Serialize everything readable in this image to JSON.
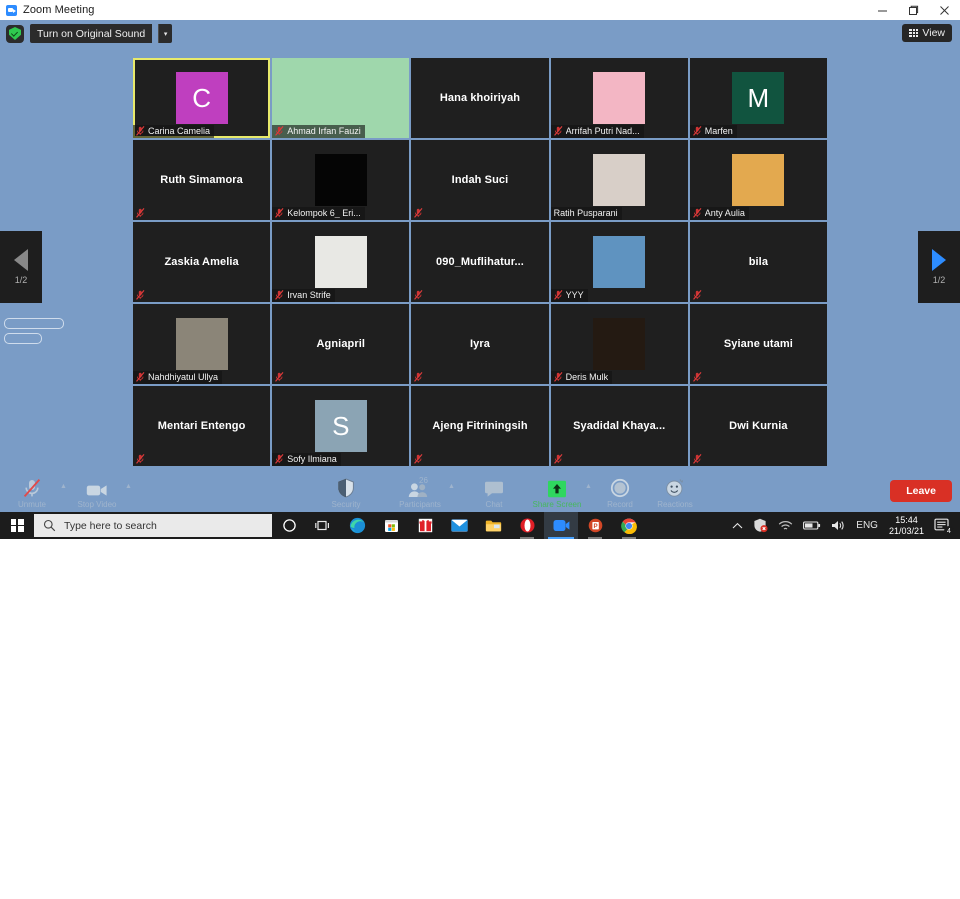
{
  "window": {
    "title": "Zoom Meeting",
    "app_icon": "zoom-icon",
    "minimize": "minimize-icon",
    "maximize": "maximize-icon",
    "close": "close-icon"
  },
  "topbar": {
    "shield_icon": "shield-check-icon",
    "original_sound_label": "Turn on Original Sound",
    "original_sound_caret": "▾",
    "view_label": "View",
    "view_icon": "grid-icon"
  },
  "gallery": {
    "page_prev_label": "1/2",
    "page_next_label": "1/2",
    "active_speaker": "Carina Camelia",
    "participants": [
      {
        "name": "Carina Camelia",
        "display": "bottom",
        "muted": true,
        "kind": "avatar-letter",
        "letter": "C",
        "color": "#bf3fbf",
        "active": true
      },
      {
        "name": "Ahmad Irfan Fauzi",
        "display": "bottom",
        "muted": true,
        "kind": "video",
        "color": "#9fd7ac"
      },
      {
        "name": "Hana khoiriyah",
        "display": "center",
        "muted": false,
        "kind": "none"
      },
      {
        "name": "Arrifah Putri Nad...",
        "display": "bottom",
        "muted": true,
        "kind": "photo",
        "color": "#f3b6c4"
      },
      {
        "name": "Marfen",
        "display": "bottom",
        "muted": true,
        "kind": "avatar-letter",
        "letter": "M",
        "color": "#11543f"
      },
      {
        "name": "Ruth Simamora",
        "display": "center",
        "muted": true,
        "kind": "none"
      },
      {
        "name": "Kelompok 6_ Eri...",
        "display": "bottom",
        "muted": true,
        "kind": "photo",
        "color": "#050505"
      },
      {
        "name": "Indah Suci",
        "display": "center",
        "muted": true,
        "kind": "none"
      },
      {
        "name": "Ratih Pusparani",
        "display": "bottom",
        "muted": false,
        "kind": "photo",
        "color": "#d8cfc8"
      },
      {
        "name": "Anty Aulia",
        "display": "bottom",
        "muted": true,
        "kind": "photo",
        "color": "#e3a94f"
      },
      {
        "name": "Zaskia Amelia",
        "display": "center",
        "muted": true,
        "kind": "none"
      },
      {
        "name": "Irvan Strife",
        "display": "bottom",
        "muted": true,
        "kind": "photo",
        "color": "#e8e8e4"
      },
      {
        "name": "090_Muflihatur...",
        "display": "center",
        "muted": true,
        "kind": "none"
      },
      {
        "name": "YYY",
        "display": "bottom",
        "muted": true,
        "kind": "photo",
        "color": "#5f93c0"
      },
      {
        "name": "bila",
        "display": "center",
        "muted": true,
        "kind": "none"
      },
      {
        "name": "Nahdhiyatul Ullya",
        "display": "bottom",
        "muted": true,
        "kind": "photo",
        "color": "#8b8578"
      },
      {
        "name": "Agniapril",
        "display": "center",
        "muted": true,
        "kind": "none"
      },
      {
        "name": "Iyra",
        "display": "center",
        "muted": true,
        "kind": "none"
      },
      {
        "name": "Deris Mulk",
        "display": "bottom",
        "muted": true,
        "kind": "photo",
        "color": "#241a12"
      },
      {
        "name": "Syiane utami",
        "display": "center",
        "muted": true,
        "kind": "none"
      },
      {
        "name": "Mentari Entengo",
        "display": "center",
        "muted": true,
        "kind": "none"
      },
      {
        "name": "Sofy Ilmiana",
        "display": "bottom",
        "muted": true,
        "kind": "avatar-letter",
        "letter": "S",
        "color": "#8ba4b4"
      },
      {
        "name": "Ajeng Fitriningsih",
        "display": "center",
        "muted": true,
        "kind": "none"
      },
      {
        "name": "Syadidal  Khaya...",
        "display": "center",
        "muted": true,
        "kind": "none"
      },
      {
        "name": "Dwi Kurnia",
        "display": "center",
        "muted": true,
        "kind": "none"
      }
    ]
  },
  "toolbar": {
    "items": [
      {
        "label": "Unmute",
        "icon": "microphone-muted-icon",
        "caret": true,
        "state": "muted"
      },
      {
        "label": "Stop Video",
        "icon": "video-camera-icon",
        "caret": true,
        "state": "on"
      },
      {
        "label": "Security",
        "icon": "shield-icon",
        "caret": false,
        "state": "on"
      },
      {
        "label": "Participants",
        "icon": "participants-icon",
        "caret": true,
        "state": "on",
        "count": "26"
      },
      {
        "label": "Chat",
        "icon": "chat-bubble-icon",
        "caret": false,
        "state": "on"
      },
      {
        "label": "Share Screen",
        "icon": "share-screen-icon",
        "caret": true,
        "state": "highlight"
      },
      {
        "label": "Record",
        "icon": "record-icon",
        "caret": false,
        "state": "on"
      },
      {
        "label": "Reactions",
        "icon": "reactions-icon",
        "caret": false,
        "state": "on"
      }
    ],
    "leave_label": "Leave",
    "accent_green": "#2fd75f",
    "leave_color": "#d93025"
  },
  "taskbar": {
    "start_icon": "windows-start-icon",
    "search_placeholder": "Type here to search",
    "search_icon": "search-icon",
    "apps": [
      {
        "name": "cortana-icon",
        "state": "idle"
      },
      {
        "name": "task-view-icon",
        "state": "idle"
      },
      {
        "name": "microsoft-edge-icon",
        "state": "idle"
      },
      {
        "name": "microsoft-store-icon",
        "state": "idle"
      },
      {
        "name": "rewards-gift-icon",
        "state": "idle"
      },
      {
        "name": "mail-icon",
        "state": "idle"
      },
      {
        "name": "file-explorer-icon",
        "state": "idle"
      },
      {
        "name": "opera-icon",
        "state": "open"
      },
      {
        "name": "zoom-icon",
        "state": "active"
      },
      {
        "name": "powerpoint-icon",
        "state": "open"
      },
      {
        "name": "google-chrome-icon",
        "state": "open"
      }
    ],
    "tray": {
      "overflow_icon": "chevron-up-icon",
      "security_icon": "security-alert-icon",
      "wifi_icon": "wifi-icon",
      "battery_icon": "battery-icon",
      "volume_icon": "volume-icon",
      "language": "ENG",
      "time": "15:44",
      "date": "21/03/21",
      "notification_icon": "action-center-icon",
      "notification_count": "4"
    }
  }
}
